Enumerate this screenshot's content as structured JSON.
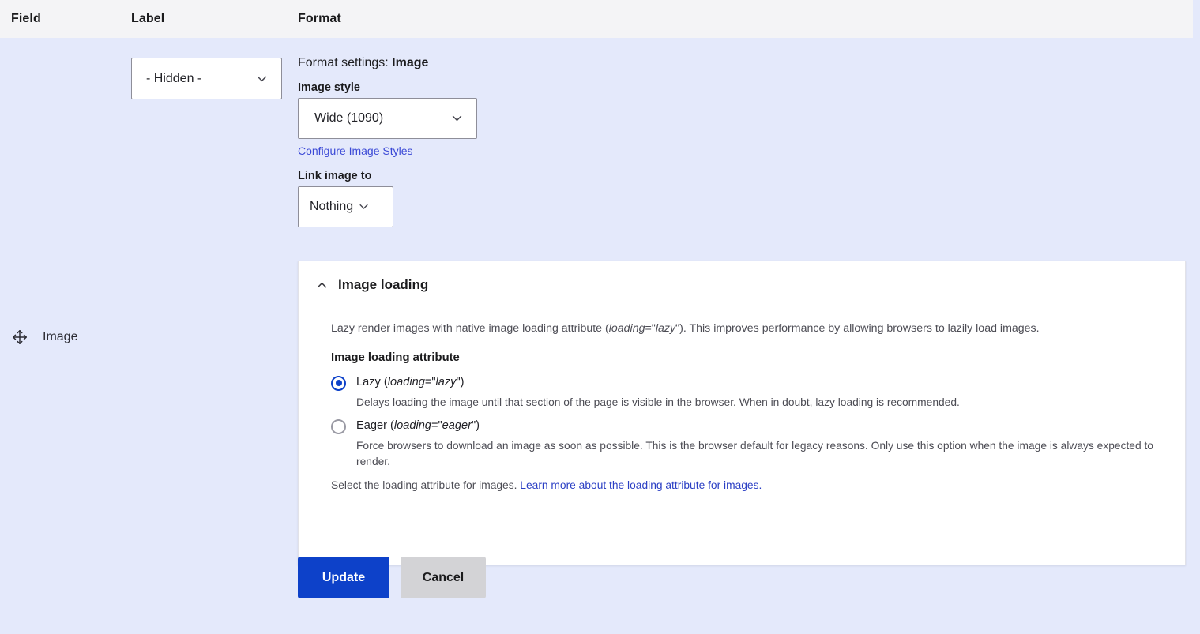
{
  "table": {
    "headers": {
      "field": "Field",
      "label": "Label",
      "format": "Format"
    }
  },
  "row": {
    "field_name": "Image",
    "drag_handle_icon": "move-handle-icon",
    "label_select": {
      "value": "- Hidden -",
      "chevron_icon": "chevron-down-icon"
    }
  },
  "format": {
    "settings_prefix": "Format settings: ",
    "settings_target": "Image",
    "image_style": {
      "label": "Image style",
      "value": "Wide (1090)",
      "chevron_icon": "chevron-down-icon"
    },
    "configure_link": "Configure Image Styles",
    "link_image_to": {
      "label": "Link image to",
      "value": "Nothing",
      "chevron_icon": "chevron-down-icon"
    },
    "image_loading": {
      "summary": "Image loading",
      "caret_icon": "chevron-up-icon",
      "description_parts": {
        "p1": "Lazy render images with native image loading attribute (",
        "em1": "loading",
        "p2": "=\"",
        "em2": "lazy",
        "p3": "\"). This improves performance by allowing browsers to lazily load images."
      },
      "attribute_label": "Image loading attribute",
      "options": [
        {
          "id": "lazy",
          "label_text": "Lazy (",
          "label_em1": "loading",
          "label_mid": "=\"",
          "label_em2": "lazy",
          "label_end": "\")",
          "checked": true,
          "description": "Delays loading the image until that section of the page is visible in the browser. When in doubt, lazy loading is recommended."
        },
        {
          "id": "eager",
          "label_text": "Eager (",
          "label_em1": "loading",
          "label_mid": "=\"",
          "label_em2": "eager",
          "label_end": "\")",
          "checked": false,
          "description": "Force browsers to download an image as soon as possible. This is the browser default for legacy reasons. Only use this option when the image is always expected to render."
        }
      ],
      "final_note": "Select the loading attribute for images. ",
      "final_note_link": "Learn more about the loading attribute for images."
    }
  },
  "actions": {
    "update_label": "Update",
    "cancel_label": "Cancel"
  },
  "colors": {
    "page_background": "#e4e9fb",
    "header_background": "#f4f4f6",
    "primary_button": "#0d41c9",
    "secondary_button": "#d3d3d6",
    "link": "#2b3fc4",
    "radio_selected": "#0d41c9"
  }
}
